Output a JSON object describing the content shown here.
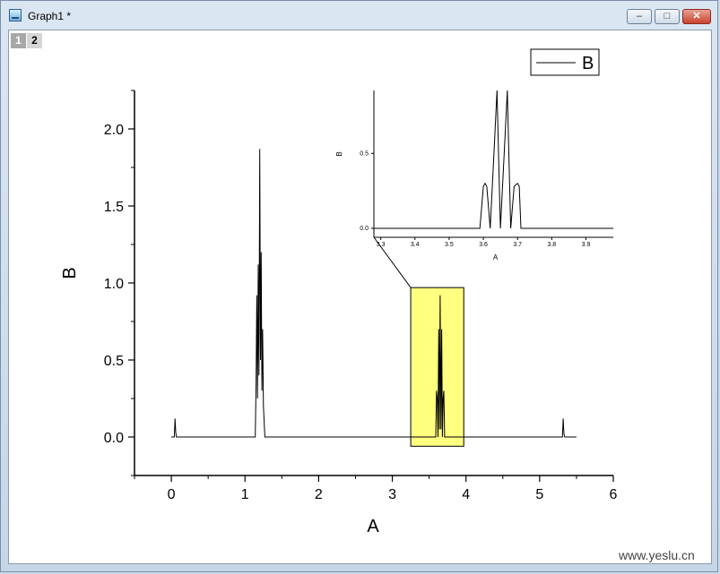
{
  "window": {
    "title": "Graph1 *",
    "icon": "graph-window-icon",
    "controls": {
      "minimize": "–",
      "maximize": "□",
      "close": "✕"
    }
  },
  "layers": {
    "tabs": [
      "1",
      "2"
    ],
    "active": "1"
  },
  "watermark": "www.yeslu.cn",
  "colors": {
    "zoom_box": "#ffff80",
    "line": "#000000",
    "background": "#ffffff"
  },
  "chart_data": [
    {
      "type": "line",
      "xlabel": "A",
      "ylabel": "B",
      "xlim": [
        -0.5,
        6
      ],
      "ylim": [
        -0.25,
        2.25
      ],
      "x_ticks": [
        0,
        1,
        2,
        3,
        4,
        5,
        6
      ],
      "x_tick_labels": [
        "0",
        "1",
        "2",
        "3",
        "4",
        "5",
        "6"
      ],
      "y_ticks": [
        0,
        0.5,
        1.0,
        1.5,
        2.0
      ],
      "y_tick_labels": [
        "0.0",
        "0.5",
        "1.0",
        "1.5",
        "2.0"
      ],
      "legend": {
        "position": "top-right",
        "entries": [
          "B"
        ]
      },
      "zoom_region": {
        "x": [
          3.25,
          3.97
        ],
        "y": [
          -0.06,
          0.97
        ]
      },
      "series": [
        {
          "name": "B",
          "x": [
            0.0,
            0.04,
            0.05,
            0.06,
            0.07,
            1.14,
            1.15,
            1.16,
            1.17,
            1.18,
            1.19,
            1.2,
            1.21,
            1.22,
            1.23,
            1.24,
            1.25,
            1.26,
            1.27,
            3.59,
            3.6,
            3.61,
            3.62,
            3.63,
            3.64,
            3.65,
            3.66,
            3.67,
            3.68,
            3.69,
            3.7,
            3.71,
            5.31,
            5.32,
            5.33,
            5.34,
            5.5
          ],
          "y": [
            0.0,
            0.0,
            0.12,
            0.03,
            0.0,
            0.0,
            0.35,
            0.92,
            0.25,
            1.12,
            0.4,
            1.87,
            0.5,
            1.2,
            0.3,
            0.7,
            0.2,
            0.1,
            0.0,
            0.0,
            0.3,
            0.25,
            0.0,
            0.7,
            0.05,
            0.92,
            0.05,
            0.7,
            0.0,
            0.25,
            0.3,
            0.0,
            0.0,
            0.12,
            0.02,
            0.0,
            0.0
          ]
        }
      ]
    },
    {
      "type": "line",
      "xlabel": "A",
      "ylabel": "B",
      "xlim": [
        3.28,
        3.98
      ],
      "ylim": [
        -0.06,
        0.92
      ],
      "x_ticks": [
        3.3,
        3.4,
        3.5,
        3.6,
        3.7,
        3.8,
        3.9
      ],
      "x_tick_labels": [
        "3.3",
        "3.4",
        "3.5",
        "3.6",
        "3.7",
        "3.8",
        "3.9"
      ],
      "y_ticks": [
        0.0,
        0.5
      ],
      "y_tick_labels": [
        "0.0",
        "0.5"
      ],
      "series": [
        {
          "name": "B",
          "x": [
            3.28,
            3.59,
            3.6,
            3.605,
            3.61,
            3.62,
            3.63,
            3.64,
            3.645,
            3.65,
            3.66,
            3.67,
            3.675,
            3.68,
            3.69,
            3.7,
            3.705,
            3.71,
            3.98
          ],
          "y": [
            0.0,
            0.0,
            0.28,
            0.3,
            0.28,
            0.0,
            0.45,
            0.92,
            0.45,
            0.0,
            0.45,
            0.92,
            0.45,
            0.0,
            0.28,
            0.3,
            0.28,
            0.0,
            0.0
          ]
        }
      ]
    }
  ]
}
